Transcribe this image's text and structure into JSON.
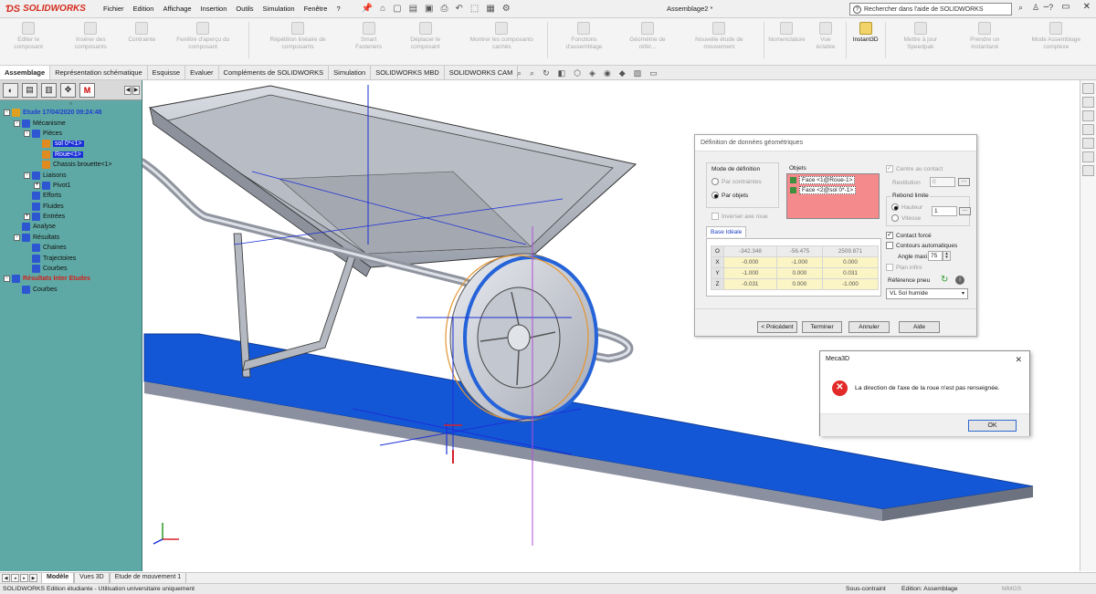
{
  "app": {
    "logo": "SOLIDWORKS",
    "document_title": "Assemblage2 *"
  },
  "menu": [
    "Fichier",
    "Edition",
    "Affichage",
    "Insertion",
    "Outils",
    "Simulation",
    "Fenêtre",
    "?"
  ],
  "help_search": {
    "placeholder": "Rechercher dans l'aide de SOLIDWORKS"
  },
  "ribbon": [
    {
      "label": "Editer le composant",
      "active": false
    },
    {
      "label": "Insérer des composants",
      "active": false
    },
    {
      "label": "Contrainte",
      "active": false
    },
    {
      "label": "Fenêtre d'aperçu du composant",
      "active": false
    },
    {
      "label": "Répétition linéaire de composants",
      "active": false
    },
    {
      "label": "Smart Fasteners",
      "active": false
    },
    {
      "label": "Déplacer le composant",
      "active": false
    },
    {
      "label": "Montrer les composants cachés",
      "active": false
    },
    {
      "label": "Fonctions d'assemblage",
      "active": false
    },
    {
      "label": "Géométrie de référ...",
      "active": false
    },
    {
      "label": "Nouvelle étude de mouvement",
      "active": false
    },
    {
      "label": "Nomenclature",
      "active": false
    },
    {
      "label": "Vue éclatée",
      "active": false
    },
    {
      "label": "Instant3D",
      "active": true
    },
    {
      "label": "Mettre à jour Speedpak",
      "active": false
    },
    {
      "label": "Prendre un instantané",
      "active": false
    },
    {
      "label": "Mode Assemblage complexe",
      "active": false
    }
  ],
  "command_tabs": [
    {
      "label": "Assemblage",
      "active": true
    },
    {
      "label": "Représentation schématique",
      "active": false
    },
    {
      "label": "Esquisse",
      "active": false
    },
    {
      "label": "Evaluer",
      "active": false
    },
    {
      "label": "Compléments de SOLIDWORKS",
      "active": false
    },
    {
      "label": "Simulation",
      "active": false
    },
    {
      "label": "SOLIDWORKS MBD",
      "active": false
    },
    {
      "label": "SOLIDWORKS CAM",
      "active": false
    }
  ],
  "panel_tab_m": "M",
  "tree": [
    {
      "label": "Etude 17/04/2020 09:24:48",
      "level": 0,
      "pm": "-",
      "style": "study",
      "icon_color": "#e0a020"
    },
    {
      "label": "Mécanisme",
      "level": 1,
      "pm": "-",
      "style": "",
      "icon_color": "#2d56d1"
    },
    {
      "label": "Pièces",
      "level": 2,
      "pm": "-",
      "style": "",
      "icon_color": "#2d56d1"
    },
    {
      "label": "sol 0*<1>",
      "level": 3,
      "pm": "",
      "style": "sel",
      "icon_color": "#e08a20"
    },
    {
      "label": "Roue<1>",
      "level": 3,
      "pm": "",
      "style": "sel",
      "icon_color": "#e08a20"
    },
    {
      "label": "Chassis brouette<1>",
      "level": 3,
      "pm": "",
      "style": "",
      "icon_color": "#e08a20"
    },
    {
      "label": "Liaisons",
      "level": 2,
      "pm": "-",
      "style": "",
      "icon_color": "#2d56d1"
    },
    {
      "label": "Pivot1",
      "level": 3,
      "pm": "+",
      "style": "",
      "icon_color": "#2d56d1"
    },
    {
      "label": "Efforts",
      "level": 2,
      "pm": "",
      "style": "",
      "icon_color": "#2d56d1"
    },
    {
      "label": "Fluides",
      "level": 2,
      "pm": "",
      "style": "",
      "icon_color": "#2d56d1"
    },
    {
      "label": "Entrées",
      "level": 2,
      "pm": "+",
      "style": "",
      "icon_color": "#2d56d1"
    },
    {
      "label": "Analyse",
      "level": 1,
      "pm": "",
      "style": "",
      "icon_color": "#2d56d1"
    },
    {
      "label": "Résultats",
      "level": 1,
      "pm": "-",
      "style": "",
      "icon_color": "#2d56d1"
    },
    {
      "label": "Chaines",
      "level": 2,
      "pm": "",
      "style": "",
      "icon_color": "#2d56d1"
    },
    {
      "label": "Trajectoires",
      "level": 2,
      "pm": "",
      "style": "",
      "icon_color": "#2d56d1"
    },
    {
      "label": "Courbes",
      "level": 2,
      "pm": "",
      "style": "",
      "icon_color": "#2d56d1"
    },
    {
      "label": "Résultats Inter Etudes",
      "level": 0,
      "pm": "-",
      "style": "red",
      "icon_color": "#2d56d1"
    },
    {
      "label": "Courbes",
      "level": 1,
      "pm": "",
      "style": "",
      "icon_color": "#2d56d1"
    }
  ],
  "geo_dialog": {
    "title": "Définition de données géométriques",
    "mode_title": "Mode de définition",
    "mode_contraintes": "Par contraintes",
    "mode_objets": "Par objets",
    "inverser": "Inverser axe roue",
    "objets_title": "Objets",
    "objets": [
      "Face <1@Roue-1>",
      "Face <2@sol 0*-1>"
    ],
    "base_tab": "Base Idéale",
    "grid": [
      {
        "h": "O",
        "v": [
          "-342.348",
          "-56.475",
          "2509.871"
        ]
      },
      {
        "h": "X",
        "v": [
          "-0.000",
          "-1.000",
          "0.000"
        ]
      },
      {
        "h": "Y",
        "v": [
          "-1.000",
          "0.000",
          "0.031"
        ]
      },
      {
        "h": "Z",
        "v": [
          "-0.031",
          "0.000",
          "-1.000"
        ]
      }
    ],
    "centre_contact": "Centre au contact",
    "restitution_label": "Restitution",
    "restitution_value": "0",
    "rebond_title": "Rebond limite",
    "hauteur": "Hauteur",
    "vitesse": "Vitesse",
    "rebond_value": "1",
    "contact_force": "Contact forcé",
    "contours_auto": "Contours automatiques",
    "angle_label": "Angle maxi",
    "angle_value": "75",
    "plan_infini": "Plan infini",
    "ref_pneu": "Référence pneu",
    "ref_pneu_value": "VL Sol humide",
    "btn_prev": "< Précédent",
    "btn_finish": "Terminer",
    "btn_cancel": "Annuler",
    "btn_help": "Aide"
  },
  "msg_dialog": {
    "title": "Meca3D",
    "text": "La direction de l'axe de la roue n'est pas renseignée.",
    "ok": "OK"
  },
  "bottom_tabs": [
    {
      "label": "Modèle",
      "active": true
    },
    {
      "label": "Vues 3D",
      "active": false
    },
    {
      "label": "Etude de mouvement 1",
      "active": false
    }
  ],
  "status": {
    "left": "SOLIDWORKS Edition étudiante - Utilisation universitaire uniquement",
    "sous_contraint": "Sous-contraint",
    "edition": "Edition: Assemblage",
    "units": "MMGS"
  },
  "colors": {
    "tree_bg": "#5ea9a5",
    "ramp": "#1457d6",
    "objets_bg": "#f58a8d",
    "error": "#e32a2a"
  }
}
